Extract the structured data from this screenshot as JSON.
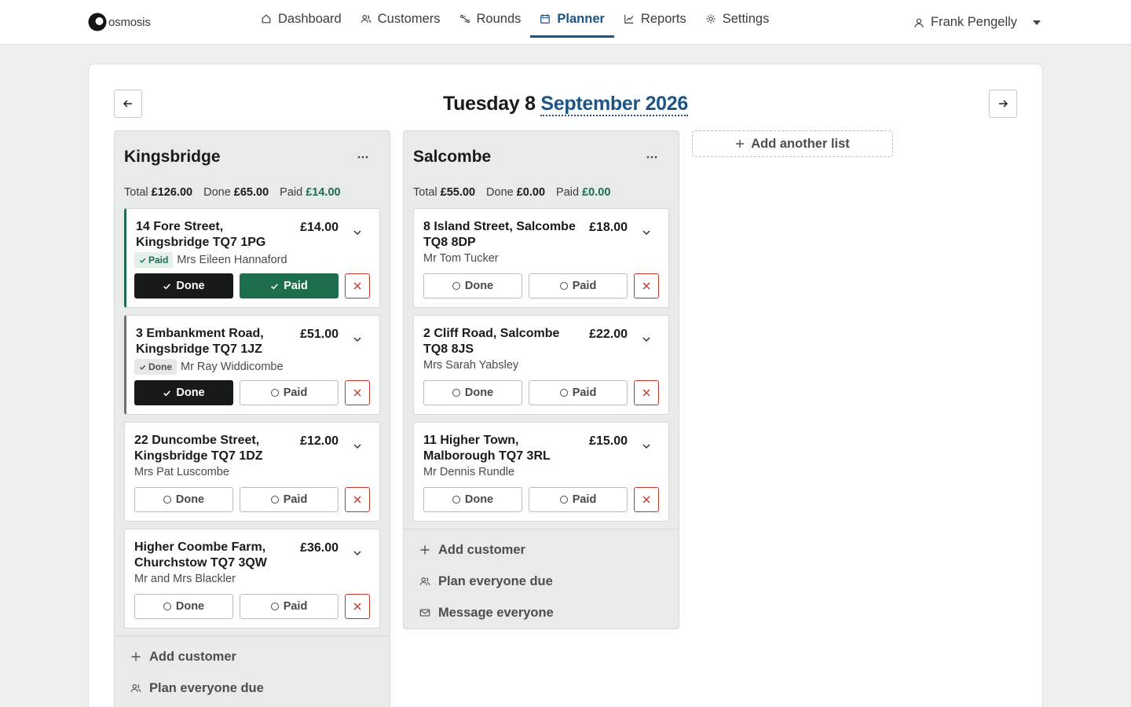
{
  "app": {
    "name": "osmosis"
  },
  "nav": {
    "items": [
      {
        "label": "Dashboard",
        "icon": "home-icon"
      },
      {
        "label": "Customers",
        "icon": "users-icon"
      },
      {
        "label": "Rounds",
        "icon": "route-icon"
      },
      {
        "label": "Planner",
        "icon": "calendar-icon",
        "active": true
      },
      {
        "label": "Reports",
        "icon": "chart-line-icon"
      },
      {
        "label": "Settings",
        "icon": "gear-icon"
      }
    ],
    "user": "Frank Pengelly"
  },
  "planner": {
    "date_prefix": "Tuesday 8",
    "date_month": "September 2026",
    "add_list_label": "Add another list"
  },
  "labels": {
    "total": "Total",
    "done": "Done",
    "paid": "Paid",
    "done_btn": "Done",
    "paid_btn": "Paid",
    "add_customer": "Add customer",
    "plan_everyone": "Plan everyone due",
    "message_everyone": "Message everyone"
  },
  "lists": [
    {
      "title": "Kingsbridge",
      "total": "£126.00",
      "done": "£65.00",
      "paid": "£14.00",
      "stops": [
        {
          "address": "14 Fore Street, Kingsbridge TQ7 1PG",
          "price": "£14.00",
          "badge": "Paid",
          "customer": "Mrs Eileen Hannaford",
          "done": true,
          "paid": true
        },
        {
          "address": "3 Embankment Road, Kingsbridge TQ7 1JZ",
          "price": "£51.00",
          "badge": "Done",
          "customer": "Mr Ray Widdicombe",
          "done": true,
          "paid": false
        },
        {
          "address": "22 Duncombe Street, Kingsbridge TQ7 1DZ",
          "price": "£12.00",
          "badge": "",
          "customer": "Mrs Pat Luscombe",
          "done": false,
          "paid": false
        },
        {
          "address": "Higher Coombe Farm, Churchstow TQ7 3QW",
          "price": "£36.00",
          "badge": "",
          "customer": "Mr and Mrs Blackler",
          "done": false,
          "paid": false
        }
      ]
    },
    {
      "title": "Salcombe",
      "total": "£55.00",
      "done": "£0.00",
      "paid": "£0.00",
      "stops": [
        {
          "address": "8 Island Street, Salcombe TQ8 8DP",
          "price": "£18.00",
          "badge": "",
          "customer": "Mr Tom Tucker",
          "done": false,
          "paid": false
        },
        {
          "address": "2 Cliff Road, Salcombe TQ8 8JS",
          "price": "£22.00",
          "badge": "",
          "customer": "Mrs Sarah Yabsley",
          "done": false,
          "paid": false
        },
        {
          "address": "11 Higher Town, Malborough TQ7 3RL",
          "price": "£15.00",
          "badge": "",
          "customer": "Mr Dennis Rundle",
          "done": false,
          "paid": false
        }
      ]
    }
  ],
  "colors": {
    "brand": "#1b5488",
    "success": "#1c6e4c",
    "danger": "#c0392b",
    "dark": "#161a19"
  }
}
